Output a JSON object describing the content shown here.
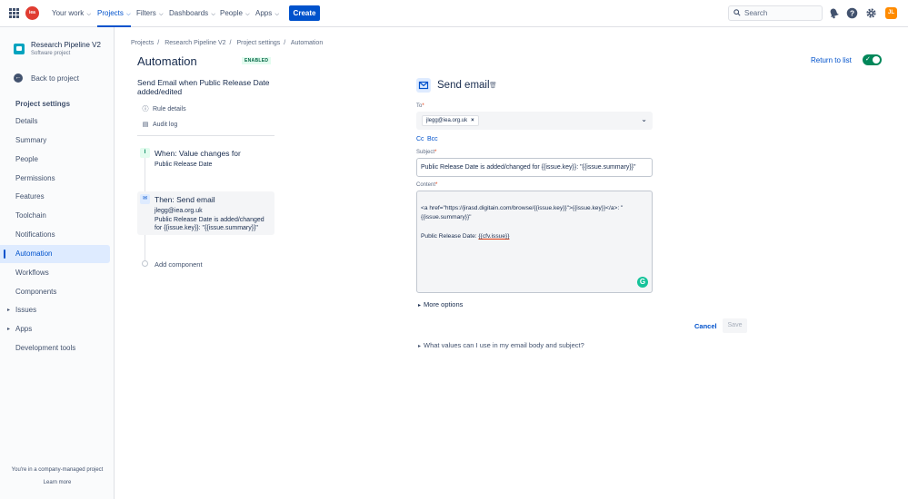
{
  "topnav": {
    "logo_text": "iea",
    "items": [
      {
        "label": "Your work"
      },
      {
        "label": "Projects"
      },
      {
        "label": "Filters"
      },
      {
        "label": "Dashboards"
      },
      {
        "label": "People"
      },
      {
        "label": "Apps"
      }
    ],
    "create_label": "Create",
    "search_placeholder": "Search",
    "avatar_initials": "JL",
    "icons": [
      "notifications-icon",
      "help-icon",
      "settings-icon"
    ]
  },
  "sidebar": {
    "project_name": "Research Pipeline V2",
    "project_type": "Software project",
    "back_label": "Back to project",
    "section_heading": "Project settings",
    "items": [
      {
        "label": "Details"
      },
      {
        "label": "Summary"
      },
      {
        "label": "People"
      },
      {
        "label": "Permissions"
      },
      {
        "label": "Features"
      },
      {
        "label": "Toolchain"
      },
      {
        "label": "Notifications"
      },
      {
        "label": "Automation"
      },
      {
        "label": "Workflows"
      },
      {
        "label": "Components"
      },
      {
        "label": "Issues"
      },
      {
        "label": "Apps"
      },
      {
        "label": "Development tools"
      }
    ],
    "footer_text": "You're in a company-managed project",
    "learn_more": "Learn more"
  },
  "breadcrumb": [
    "Projects",
    "Research Pipeline V2",
    "Project settings",
    "Automation"
  ],
  "page": {
    "title": "Automation",
    "status_badge": "ENABLED",
    "return_label": "Return to list"
  },
  "rule": {
    "title": "Send Email when Public Release Date added/edited",
    "rule_details": "Rule details",
    "audit_log": "Audit log",
    "trigger_title": "When: Value changes for",
    "trigger_sub": "Public Release Date",
    "action_title": "Then: Send email",
    "action_sub1": "jlegg@iea.org.uk",
    "action_sub2": "Public Release Date is added/changed",
    "action_sub3": "for {{issue.key}}: \"{{issue.summary}}\"",
    "add_component": "Add component"
  },
  "email_form": {
    "title": "Send email",
    "to_label": "To",
    "to_chip": "jlegg@iea.org.uk",
    "cc_label": "Cc",
    "bcc_label": "Bcc",
    "subject_label": "Subject",
    "subject_value": "Public Release Date is added/changed for {{issue.key}}: \"{{issue.summary}}\"",
    "content_label": "Content",
    "content_line1": "<a href=\"https://jirasd.digitain.com/browse/{{issue.key}}\">{{issue.key}}</a>: \"",
    "content_line2": "{{issue.summary}}\"",
    "content_line3_prefix": "Public Release Date: ",
    "content_line3_var": "{{cfv.issue}}",
    "more_options": "More options",
    "cancel_label": "Cancel",
    "save_label": "Save",
    "help_text": "What values can I use in my email body and subject?"
  },
  "colors": {
    "primary": "#0052CC",
    "enabled_green": "#00875A",
    "logo_red": "#E03C31"
  }
}
